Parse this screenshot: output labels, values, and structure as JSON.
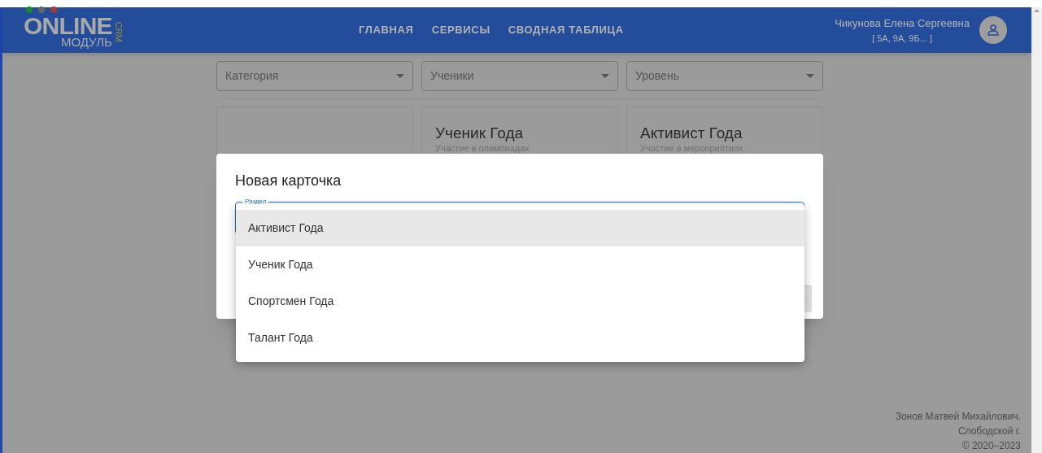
{
  "header": {
    "logo": {
      "word": "ONLINE",
      "sub": "МОДУЛЬ",
      "badge": "CRM"
    },
    "nav": [
      "ГЛАВНАЯ",
      "СЕРВИСЫ",
      "СВОДНАЯ ТАБЛИЦА"
    ],
    "user": {
      "name": "Чикунова Елена Сергеевна",
      "classes": "[ 5А, 9А, 9Б... ]"
    }
  },
  "filters": [
    {
      "placeholder": "Категория"
    },
    {
      "placeholder": "Ученики"
    },
    {
      "placeholder": "Уровень"
    }
  ],
  "cards": [
    {
      "kind": "empty"
    },
    {
      "kind": "award",
      "title": "Ученик Года",
      "subtitle": "Участие в олимпиадах"
    },
    {
      "kind": "award",
      "title": "Активист Года",
      "subtitle": "Участие в мероприятиях"
    }
  ],
  "dialog": {
    "title": "Новая карточка",
    "field_label": "Раздел",
    "options": [
      {
        "label": "Активист Года",
        "selected": true
      },
      {
        "label": "Ученик Года",
        "selected": false
      },
      {
        "label": "Спортсмен Года",
        "selected": false
      },
      {
        "label": "Талант Года",
        "selected": false
      }
    ]
  },
  "footer": [
    "Зонов Матвей Михайлович.",
    "Слободской г.",
    "© 2020–2023"
  ]
}
